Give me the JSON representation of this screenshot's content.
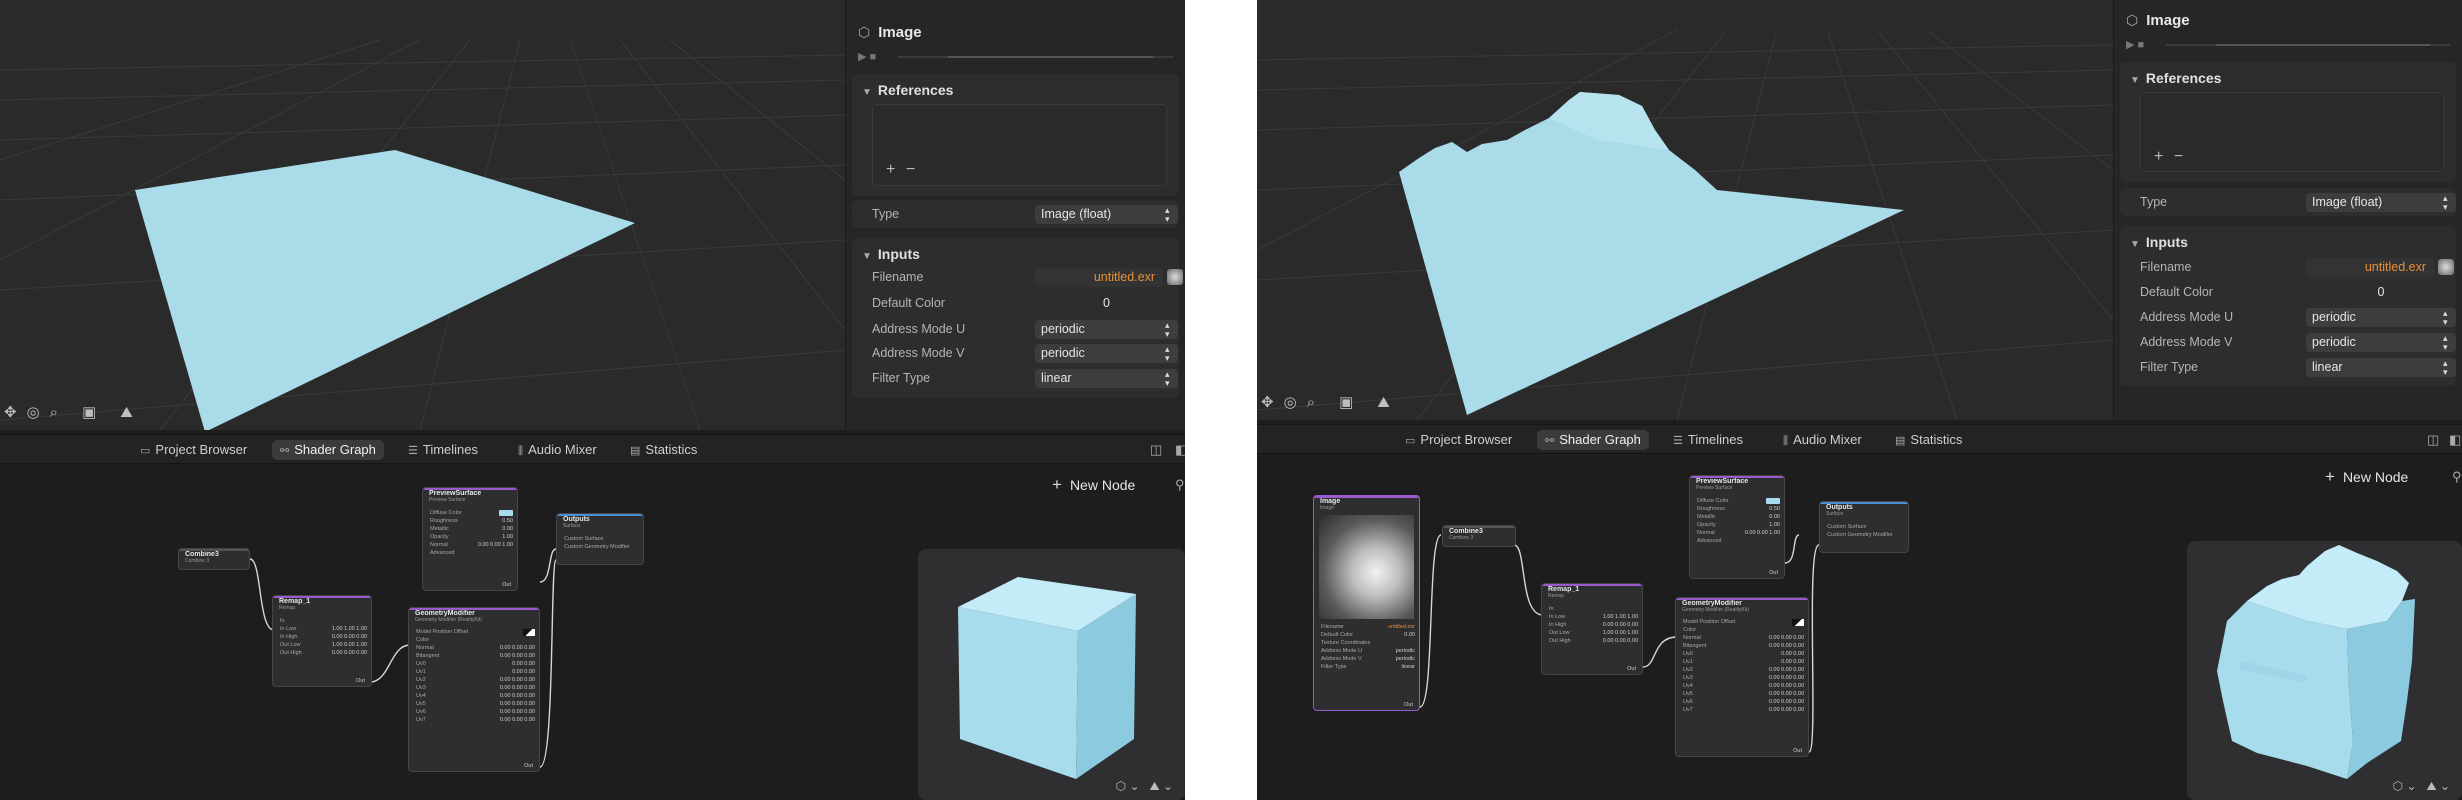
{
  "inspector": {
    "title": "Image",
    "references_header": "References",
    "add_label": "+",
    "remove_label": "−",
    "type_label": "Type",
    "type_value": "Image (float)",
    "inputs_header": "Inputs",
    "fields": [
      {
        "label": "Filename",
        "value": "untitled.exr"
      },
      {
        "label": "Default Color",
        "value": "0"
      },
      {
        "label": "Address Mode U",
        "value": "periodic"
      },
      {
        "label": "Address Mode V",
        "value": "periodic"
      },
      {
        "label": "Filter Type",
        "value": "linear"
      }
    ]
  },
  "tabs": [
    {
      "label": "Project Browser",
      "icon": "folder-icon"
    },
    {
      "label": "Shader Graph",
      "icon": "nodes-icon",
      "active": true
    },
    {
      "label": "Timelines",
      "icon": "timeline-icon"
    },
    {
      "label": "Audio Mixer",
      "icon": "audio-mixer-icon"
    },
    {
      "label": "Statistics",
      "icon": "statistics-icon"
    }
  ],
  "graph": {
    "new_node_label": "New Node",
    "nodes": {
      "image": {
        "title": "Image",
        "subtitle": "Image",
        "rows": [
          {
            "k": "Filename",
            "v": "untitled.exr"
          },
          {
            "k": "Default Color",
            "v": "0.00"
          },
          {
            "k": "Texture Coordinates",
            "v": ""
          },
          {
            "k": "Address Mode U",
            "v": "periodic"
          },
          {
            "k": "Address Mode V",
            "v": "periodic"
          },
          {
            "k": "Filter Type",
            "v": "linear"
          }
        ],
        "out": "Out"
      },
      "combine": {
        "title": "Combine3",
        "subtitle": "Combine 3"
      },
      "remap": {
        "title": "Remap_1",
        "subtitle": "Remap",
        "rows": [
          {
            "k": "In",
            "v": ""
          },
          {
            "k": "In Low",
            "v": "1.00  1.00  1.00"
          },
          {
            "k": "In High",
            "v": "0.00  0.00  0.00"
          },
          {
            "k": "Out Low",
            "v": "1.00  0.00  1.00"
          },
          {
            "k": "Out High",
            "v": "0.00  0.00  0.00"
          }
        ],
        "out": "Out"
      },
      "preview": {
        "title": "PreviewSurface",
        "subtitle": "Preview Surface",
        "rows": [
          {
            "k": "Diffuse Color",
            "v": ""
          },
          {
            "k": "Roughness",
            "v": "0.50"
          },
          {
            "k": "Metallic",
            "v": "0.00"
          },
          {
            "k": "Opacity",
            "v": "1.00"
          },
          {
            "k": "Normal",
            "v": "0.00  0.00  1.00"
          },
          {
            "k": "Advanced",
            "v": ""
          }
        ],
        "out": "Out"
      },
      "outputs": {
        "title": "Outputs",
        "subtitle": "Surface",
        "rows": [
          {
            "k": "Custom Surface",
            "v": ""
          },
          {
            "k": "Custom Geometry Modifier",
            "v": ""
          }
        ]
      },
      "geo": {
        "title": "GeometryModifier",
        "subtitle": "Geometry Modifier (RealityKit)",
        "rows": [
          {
            "k": "Model Position Offset",
            "v": ""
          },
          {
            "k": "Color",
            "v": ""
          },
          {
            "k": "Normal",
            "v": "0.00  0.00  0.00"
          },
          {
            "k": "Bitangent",
            "v": "0.00  0.00  0.00"
          },
          {
            "k": "Uv0",
            "v": "0.00  0.00"
          },
          {
            "k": "Uv1",
            "v": "0.00  0.00"
          },
          {
            "k": "Uv2",
            "v": "0.00  0.00  0.00"
          },
          {
            "k": "Uv3",
            "v": "0.00  0.00  0.00"
          },
          {
            "k": "Uv4",
            "v": "0.00  0.00  0.00"
          },
          {
            "k": "Uv5",
            "v": "0.00  0.00  0.00"
          },
          {
            "k": "Uv6",
            "v": "0.00  0.00  0.00"
          },
          {
            "k": "Uv7",
            "v": "0.00  0.00  0.00"
          }
        ],
        "out": "Out"
      }
    }
  },
  "colors": {
    "surface": "#a9dbe9",
    "surface_dark": "#8ec7d8",
    "accent_orange": "#e69138",
    "node_purple": "#9b59d0",
    "node_blue": "#4a8fd9"
  }
}
